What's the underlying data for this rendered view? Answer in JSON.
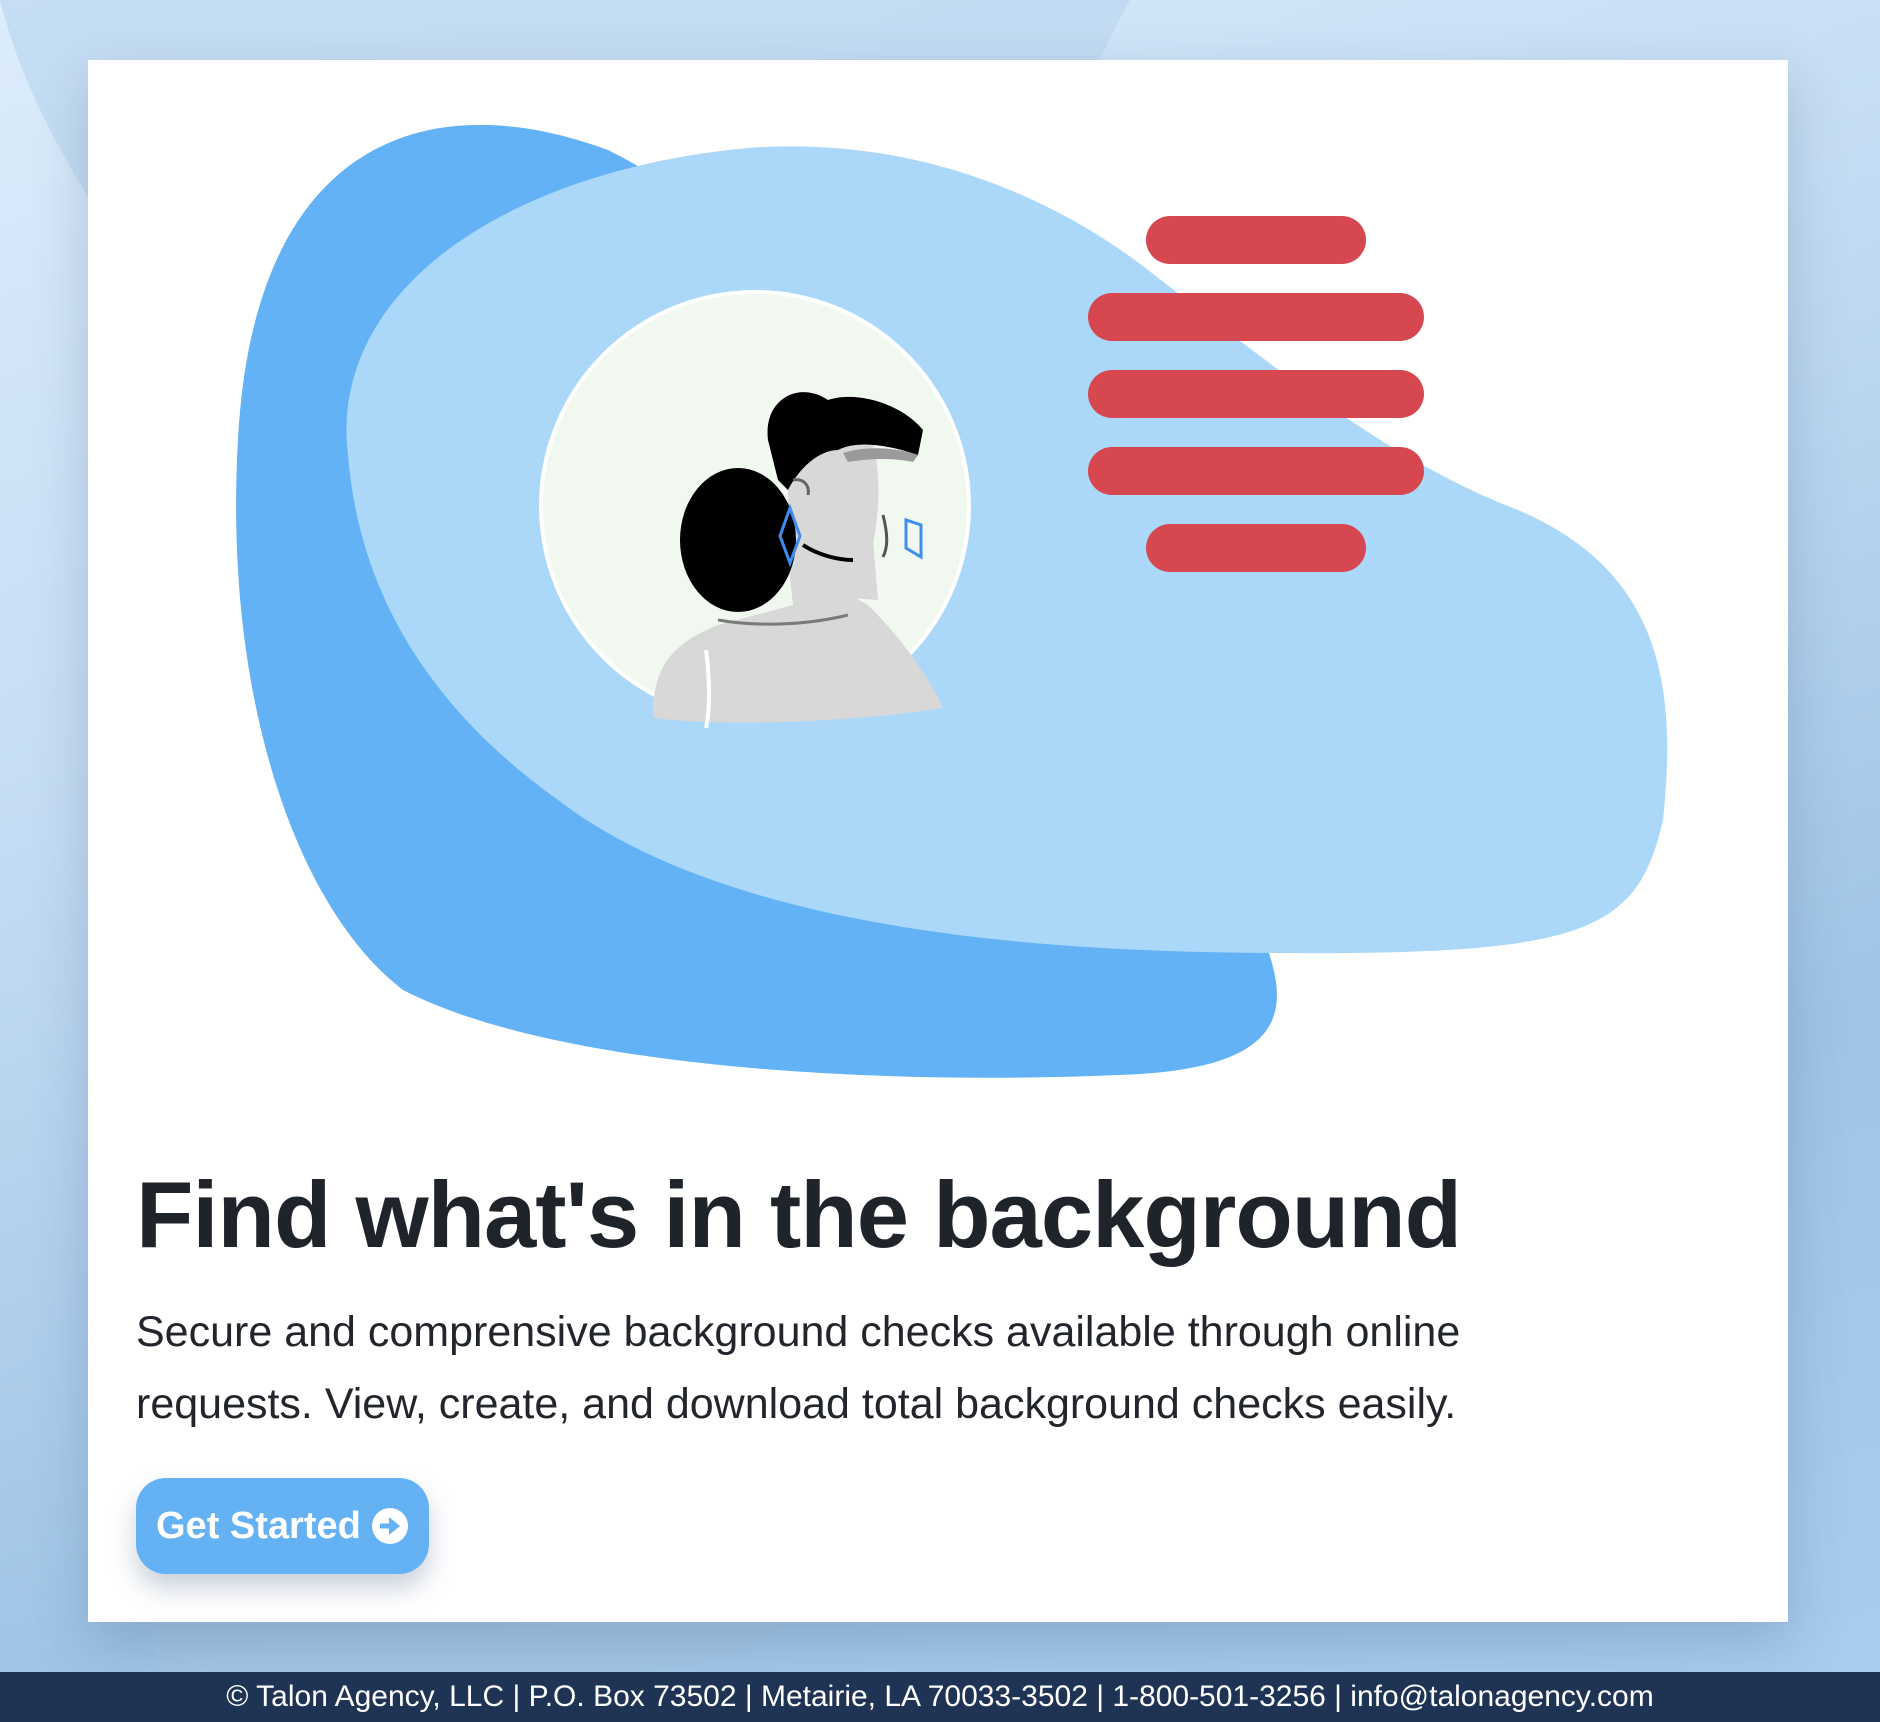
{
  "hero": {
    "headline": "Find what's in the background",
    "description": "Secure and comprensive background checks available through online requests. View, create, and download total background checks easily.",
    "cta_label": "Get Started",
    "cta_icon": "arrow-circle-right-icon",
    "illustration": "woman-profile-illustration"
  },
  "footer": {
    "text": "© Talon Agency, LLC | P.O. Box 73502 | Metairie, LA 70033-3502 | 1-800-501-3256 | info@talonagency.com"
  },
  "colors": {
    "accent": "#64b2f4",
    "blob_dark": "#62b2f5",
    "blob_light": "#abd8f9",
    "bars": "#d6474f",
    "footer_bg": "#1f3354",
    "headline": "#1f232a"
  }
}
